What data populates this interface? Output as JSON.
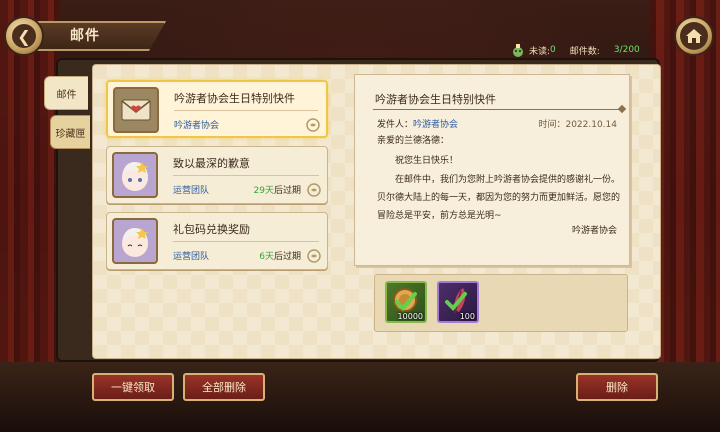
{
  "header": {
    "title": "邮件",
    "unread_label": "未读:",
    "unread_count": "0",
    "mail_count_label": "邮件数:",
    "mail_count": "3/200"
  },
  "tabs": [
    {
      "label": "邮件",
      "active": true
    },
    {
      "label": "珍藏匣",
      "active": false
    }
  ],
  "mail_list": [
    {
      "title": "吟游者协会生日特别快件",
      "sender": "吟游者协会",
      "expire_days": "",
      "expire_suffix": "",
      "selected": true,
      "icon": "envelope-icon"
    },
    {
      "title": "致以最深的歉意",
      "sender": "运营团队",
      "expire_days": "29天",
      "expire_suffix": "后过期",
      "selected": false,
      "icon": "avatar-icon"
    },
    {
      "title": "礼包码兑换奖励",
      "sender": "运营团队",
      "expire_days": "6天",
      "expire_suffix": "后过期",
      "selected": false,
      "icon": "avatar-icon"
    }
  ],
  "mail_detail": {
    "title": "吟游者协会生日特别快件",
    "from_label": "发件人：",
    "from": "吟游者协会",
    "time": "时间：2022.10.14",
    "greeting": "亲爱的兰德洛德：",
    "wish": "祝您生日快乐！",
    "body": "在邮件中，我们为您附上吟游者协会提供的感谢礼一份。贝尔德大陆上的每一天，都因为您的努力而更加鲜活。愿您的冒险总是平安，前方总是光明~",
    "signature": "吟游者协会"
  },
  "attachments": [
    {
      "icon": "coin-check-icon",
      "qty": "10000",
      "border": "#87b84c"
    },
    {
      "icon": "feather-check-icon",
      "qty": "100",
      "border": "#a47ad4"
    }
  ],
  "buttons": {
    "claim_all": "一键领取",
    "delete_all": "全部删除",
    "delete": "删除"
  },
  "colors": {
    "button_red": "#8a2a20",
    "selected_border": "#f0c64a",
    "sender_blue": "#2d5aa0",
    "expire_green": "#39a33a"
  }
}
